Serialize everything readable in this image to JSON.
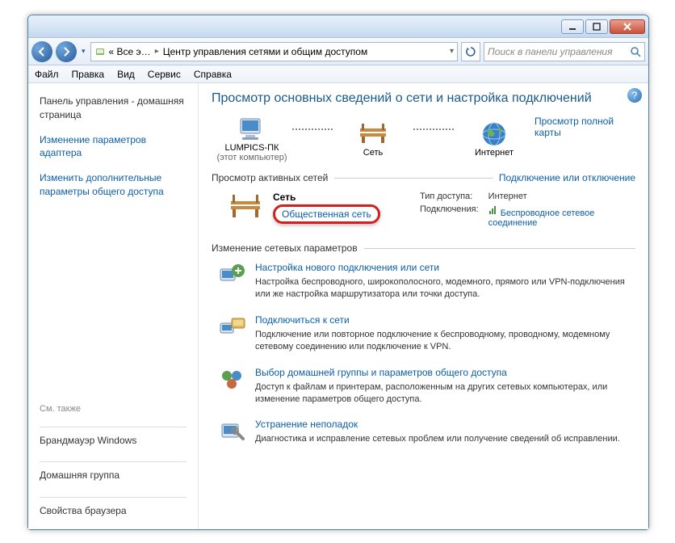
{
  "titlebar": {
    "min": "—",
    "max": "▭",
    "close": "✕"
  },
  "nav": {
    "crumb1": "« Все э…",
    "crumb2": "Центр управления сетями и общим доступом",
    "search_placeholder": "Поиск в панели управления"
  },
  "menu": {
    "file": "Файл",
    "edit": "Правка",
    "view": "Вид",
    "service": "Сервис",
    "help": "Справка"
  },
  "sidebar": {
    "home": "Панель управления - домашняя страница",
    "adapter": "Изменение параметров адаптера",
    "sharing": "Изменить дополнительные параметры общего доступа",
    "seealso": "См. также",
    "firewall": "Брандмауэр Windows",
    "homegroup": "Домашняя группа",
    "browser": "Свойства браузера"
  },
  "main": {
    "heading": "Просмотр основных сведений о сети и настройка подключений",
    "fullmap": "Просмотр полной карты",
    "pc_name": "LUMPICS-ПК",
    "pc_sub": "(этот компьютер)",
    "net_label": "Сеть",
    "inet_label": "Интернет",
    "activenets_label": "Просмотр активных сетей",
    "connect_link": "Подключение или отключение",
    "net1_name": "Сеть",
    "net1_type": "Общественная сеть",
    "access_k": "Тип доступа:",
    "access_v": "Интернет",
    "conn_k": "Подключения:",
    "conn_v": "Беспроводное сетевое соединение",
    "changeparams": "Изменение сетевых параметров",
    "task1_t": "Настройка нового подключения или сети",
    "task1_d": "Настройка беспроводного, широкополосного, модемного, прямого или VPN-подключения или же настройка маршрутизатора или точки доступа.",
    "task2_t": "Подключиться к сети",
    "task2_d": "Подключение или повторное подключение к беспроводному, проводному, модемному сетевому соединению или подключение к VPN.",
    "task3_t": "Выбор домашней группы и параметров общего доступа",
    "task3_d": "Доступ к файлам и принтерам, расположенным на других сетевых компьютерах, или изменение параметров общего доступа.",
    "task4_t": "Устранение неполадок",
    "task4_d": "Диагностика и исправление сетевых проблем или получение сведений об исправлении."
  }
}
